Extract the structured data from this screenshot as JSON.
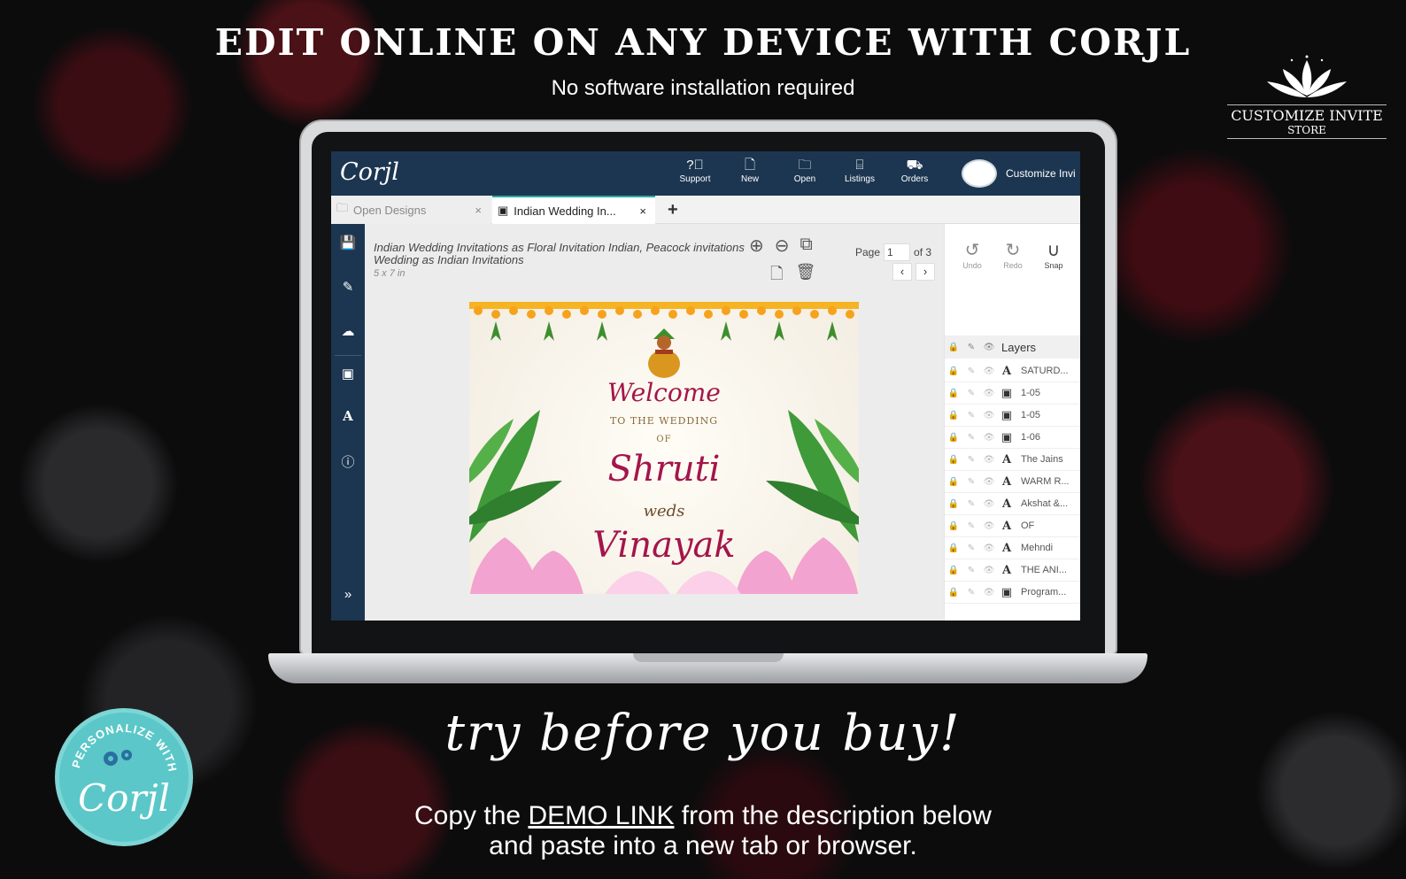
{
  "header": {
    "headline": "EDIT ONLINE ON ANY DEVICE WITH CORJL",
    "subline": "No software installation required"
  },
  "store_logo": {
    "line1": "CUSTOMIZE INVITE",
    "line2": "STORE"
  },
  "app": {
    "logo": "Corjl",
    "nav": [
      {
        "icon": "question-icon",
        "label": "Support"
      },
      {
        "icon": "new-file-icon",
        "label": "New"
      },
      {
        "icon": "folder-icon",
        "label": "Open"
      },
      {
        "icon": "gift-box-icon",
        "label": "Listings"
      },
      {
        "icon": "cart-icon",
        "label": "Orders"
      }
    ],
    "account_label": "Customize Invi",
    "tabs": [
      {
        "label": "Open Designs",
        "close": "×"
      },
      {
        "label": "Indian Wedding In...",
        "close": "×"
      }
    ],
    "tab_add": "+",
    "design": {
      "title": "Indian Wedding Invitations as Floral Invitation Indian, Peacock invitations Wedding as Indian Invitations",
      "size": "5 x 7 in"
    },
    "pager": {
      "label": "Page",
      "current": "1",
      "total": "of 3"
    },
    "history": {
      "undo": "Undo",
      "redo": "Redo",
      "snap": "Snap"
    },
    "layers_title": "Layers",
    "layers": [
      {
        "type": "text",
        "name": "SATURD..."
      },
      {
        "type": "image",
        "name": "1-05"
      },
      {
        "type": "image",
        "name": "1-05"
      },
      {
        "type": "image",
        "name": "1-06"
      },
      {
        "type": "text",
        "name": "The Jains"
      },
      {
        "type": "text",
        "name": "WARM R..."
      },
      {
        "type": "text",
        "name": "Akshat &..."
      },
      {
        "type": "text",
        "name": "OF"
      },
      {
        "type": "text",
        "name": "Mehndi"
      },
      {
        "type": "text",
        "name": "THE ANI..."
      },
      {
        "type": "image",
        "name": "Program..."
      }
    ]
  },
  "invitation": {
    "welcome": "Welcome",
    "line1": "TO THE WEDDING",
    "line2": "OF",
    "bride": "Shruti",
    "weds": "weds",
    "groom": "Vinayak"
  },
  "tagline": "try before you buy!",
  "cta": {
    "prefix": "Copy the ",
    "link": "DEMO LINK",
    "suffix": " from the description below",
    "line2": "and paste into a new tab or browser."
  },
  "badge": {
    "arc_text": "PERSONALIZE WITH",
    "brand": "Corjl"
  },
  "colors": {
    "app_navy": "#1c3651",
    "accent_teal": "#2eaa9e",
    "invite_magenta": "#a4154a",
    "badge_teal": "#5bc7c8"
  }
}
